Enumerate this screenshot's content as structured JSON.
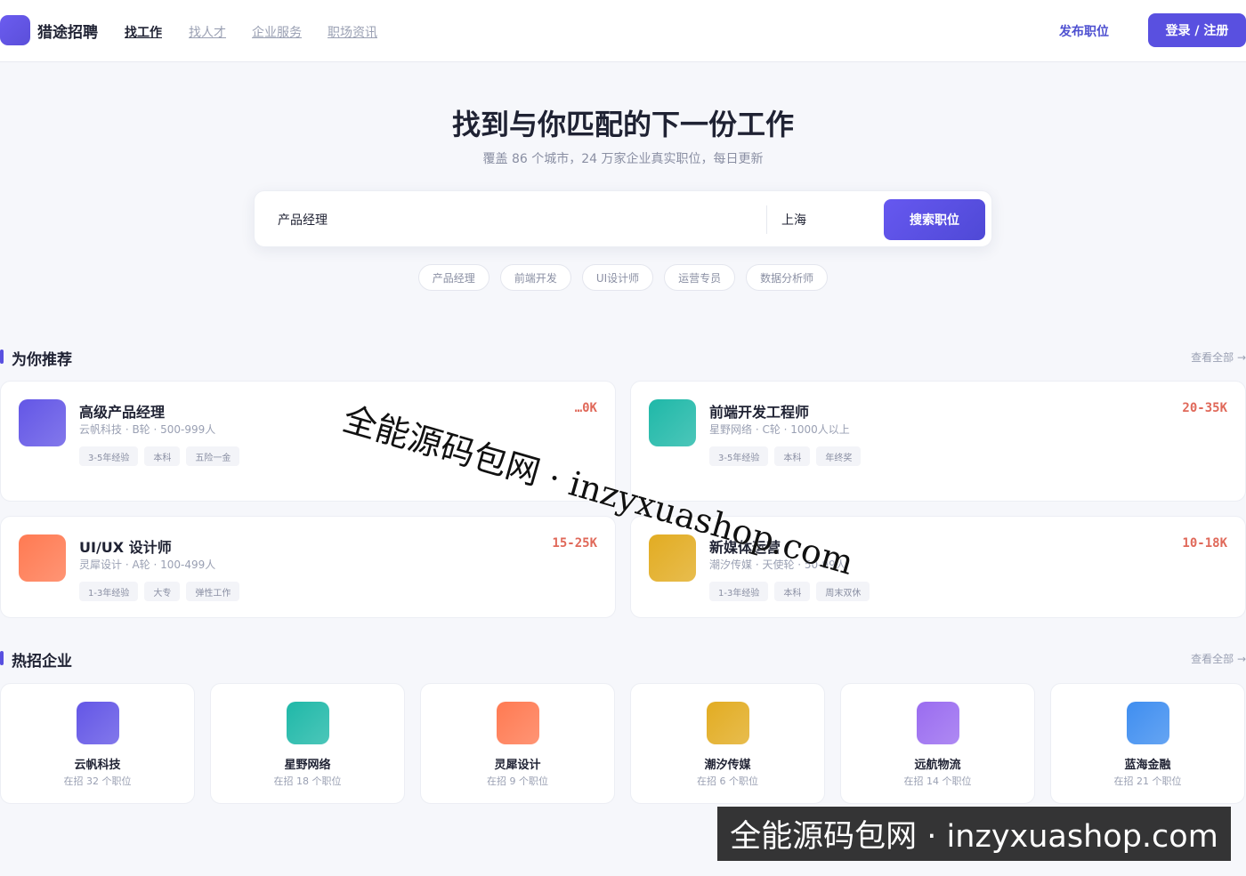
{
  "header": {
    "brand": "猎途招聘",
    "nav": [
      "找工作",
      "找人才",
      "企业服务",
      "职场资讯"
    ],
    "post_job": "发布职位",
    "login": "登录 / 注册"
  },
  "hero": {
    "title": "找到与你匹配的下一份工作",
    "subtitle": "覆盖 86 个城市，24 万家企业真实职位，每日更新",
    "search_value": "产品经理",
    "city_value": "上海",
    "search_button": "搜索职位",
    "hot_tags": [
      "产品经理",
      "前端开发",
      "UI设计师",
      "运营专员",
      "数据分析师"
    ]
  },
  "recommend": {
    "title": "为你推荐",
    "view_all": "查看全部 →",
    "jobs": [
      {
        "title": "高级产品经理",
        "company": "云帆科技 · B轮 · 500-999人",
        "salary": "…0K",
        "tags": [
          "3-5年经验",
          "本科",
          "五险一金"
        ],
        "color": "#6356e6"
      },
      {
        "title": "前端开发工程师",
        "company": "星野网络 · C轮 · 1000人以上",
        "salary": "20-35K",
        "tags": [
          "3-5年经验",
          "本科",
          "年终奖"
        ],
        "color": "#1fb8a8"
      },
      {
        "title": "UI/UX 设计师",
        "company": "灵犀设计 · A轮 · 100-499人",
        "salary": "15-25K",
        "tags": [
          "1-3年经验",
          "大专",
          "弹性工作"
        ],
        "color": "#ff7a52"
      },
      {
        "title": "新媒体运营",
        "company": "潮汐传媒 · 天使轮 · 50-99人",
        "salary": "10-18K",
        "tags": [
          "1-3年经验",
          "本科",
          "周末双休"
        ],
        "color": "#e2ac22"
      }
    ]
  },
  "companies": {
    "title": "热招企业",
    "view_all": "查看全部 →",
    "items": [
      {
        "name": "云帆科技",
        "count": "在招 32 个职位",
        "color": "#6356e6"
      },
      {
        "name": "星野网络",
        "count": "在招 18 个职位",
        "color": "#1fb8a8"
      },
      {
        "name": "灵犀设计",
        "count": "在招 9 个职位",
        "color": "#ff7a52"
      },
      {
        "name": "潮汐传媒",
        "count": "在招 6 个职位",
        "color": "#e2ac22"
      },
      {
        "name": "远航物流",
        "count": "在招 14 个职位",
        "color": "#9a6cf0"
      },
      {
        "name": "蓝海金融",
        "count": "在招 21 个职位",
        "color": "#3f8ef0"
      }
    ]
  },
  "watermark": {
    "diagonal": "全能源码包网 · inzyxuashop.com",
    "bar": "全能源码包网 · inzyxuashop.com"
  }
}
